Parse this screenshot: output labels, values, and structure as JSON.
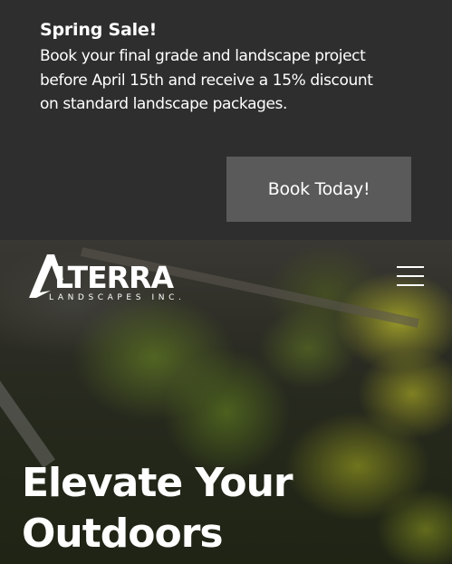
{
  "promo": {
    "title": "Spring Sale!",
    "text": "Book your final grade and landscape project before April 15th and receive a 15% discount on standard landscape packages.",
    "button_label": "Book Today!"
  },
  "header": {
    "logo_main": "ALTERRA",
    "logo_sub": "LANDSCAPES INC.",
    "menu_icon": "hamburger-menu-icon"
  },
  "hero": {
    "heading": "Elevate Your Outdoors"
  },
  "colors": {
    "promo_bg": "#2e2e2e",
    "button_bg": "#5a5a5a",
    "text": "#ffffff"
  }
}
